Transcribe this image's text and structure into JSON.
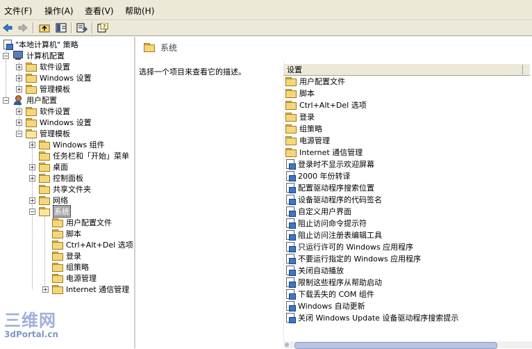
{
  "menubar": {
    "items": [
      "文件(F)",
      "操作(A)",
      "查看(V)",
      "帮助(H)"
    ]
  },
  "toolbar": {
    "buttons": [
      "back-icon",
      "forward-icon",
      "up-folder-icon",
      "show-hide-tree-icon",
      "export-list-icon",
      "help-icon"
    ]
  },
  "tree": {
    "root": "\"本地计算机\" 策略",
    "computer_config": "计算机配置",
    "cc_software": "软件设置",
    "cc_windows": "Windows 设置",
    "cc_admin": "管理模板",
    "user_config": "用户配置",
    "uc_software": "软件设置",
    "uc_windows": "Windows 设置",
    "uc_admin": "管理模板",
    "windows_components": "Windows 组件",
    "taskbar": "任务栏和「开始」菜单",
    "desktop": "桌面",
    "control_panel": "控制面板",
    "shared_folders": "共享文件夹",
    "network": "网络",
    "system": "系统",
    "sys_user_profiles": "用户配置文件",
    "sys_scripts": "脚本",
    "sys_ctrl_alt_del": "Ctrl+Alt+Del 选项",
    "sys_logon": "登录",
    "sys_group_policy": "组策略",
    "sys_power": "电源管理",
    "sys_internet": "Internet 通信管理"
  },
  "right": {
    "header": "系统",
    "description": "选择一个项目来查看它的描述。",
    "column_header": "设置",
    "items": [
      {
        "label": "用户配置文件",
        "type": "folder"
      },
      {
        "label": "脚本",
        "type": "folder"
      },
      {
        "label": "Ctrl+Alt+Del 选项",
        "type": "folder"
      },
      {
        "label": "登录",
        "type": "folder"
      },
      {
        "label": "组策略",
        "type": "folder"
      },
      {
        "label": "电源管理",
        "type": "folder"
      },
      {
        "label": "Internet 通信管理",
        "type": "folder"
      },
      {
        "label": "登录时不显示欢迎屏幕",
        "type": "setting"
      },
      {
        "label": "2000 年份转译",
        "type": "setting"
      },
      {
        "label": "配置驱动程序搜索位置",
        "type": "setting"
      },
      {
        "label": "设备驱动程序的代码签名",
        "type": "setting"
      },
      {
        "label": "自定义用户界面",
        "type": "setting"
      },
      {
        "label": "阻止访问命令提示符",
        "type": "setting"
      },
      {
        "label": "阻止访问注册表编辑工具",
        "type": "setting"
      },
      {
        "label": "只运行许可的 Windows 应用程序",
        "type": "setting"
      },
      {
        "label": "不要运行指定的 Windows 应用程序",
        "type": "setting"
      },
      {
        "label": "关闭自动播放",
        "type": "setting"
      },
      {
        "label": "限制这些程序从帮助启动",
        "type": "setting"
      },
      {
        "label": "下载丢失的 COM 组件",
        "type": "setting"
      },
      {
        "label": "Windows 自动更新",
        "type": "setting"
      },
      {
        "label": "关闭 Windows Update 设备驱动程序搜索提示",
        "type": "setting"
      }
    ]
  },
  "watermark": {
    "big": "三维网",
    "small": "3dPortal.cn"
  }
}
